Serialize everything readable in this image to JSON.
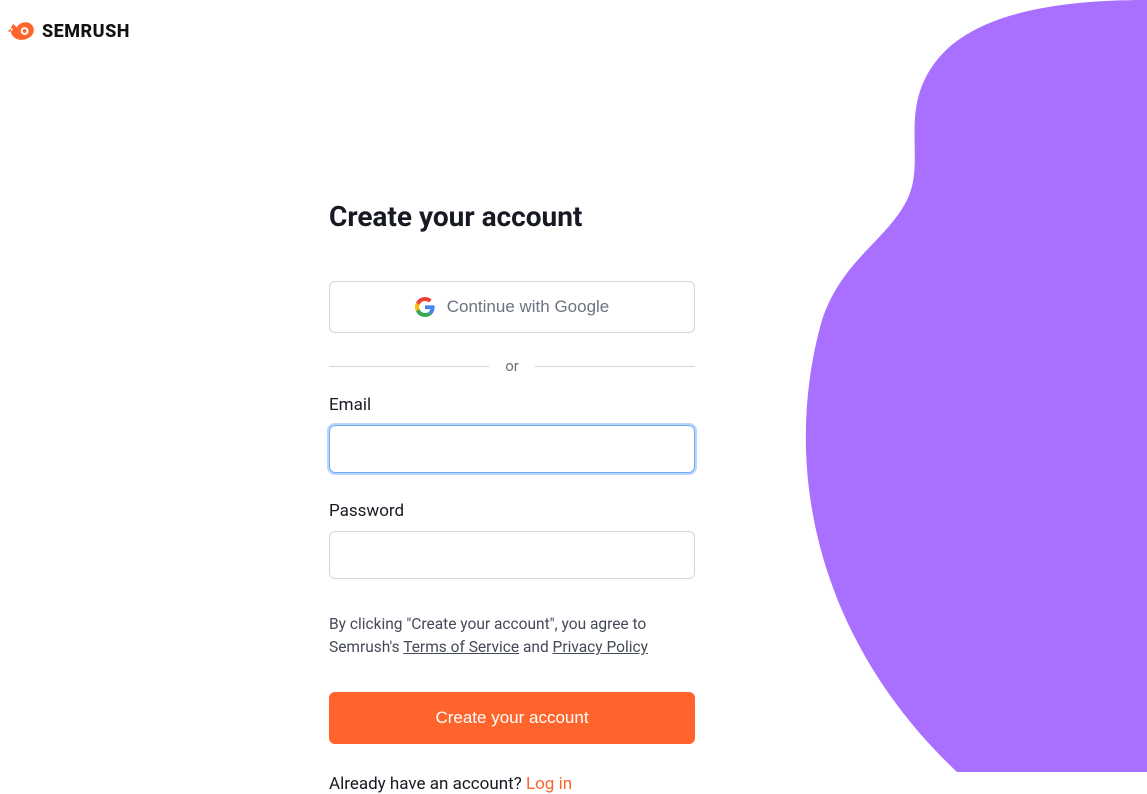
{
  "logo": {
    "brand": "SEMRUSH"
  },
  "form": {
    "heading": "Create your account",
    "google_button": "Continue with Google",
    "divider": "or",
    "email_label": "Email",
    "email_value": "",
    "password_label": "Password",
    "password_value": "",
    "terms_prefix": "By clicking \"Create your account\", you agree to Semrush's ",
    "terms_link": "Terms of Service",
    "terms_and": " and ",
    "privacy_link": "Privacy Policy",
    "submit_label": "Create your account",
    "login_prompt": "Already have an account? ",
    "login_link": "Log in"
  },
  "colors": {
    "accent": "#ff642d",
    "purple": "#a970ff"
  }
}
